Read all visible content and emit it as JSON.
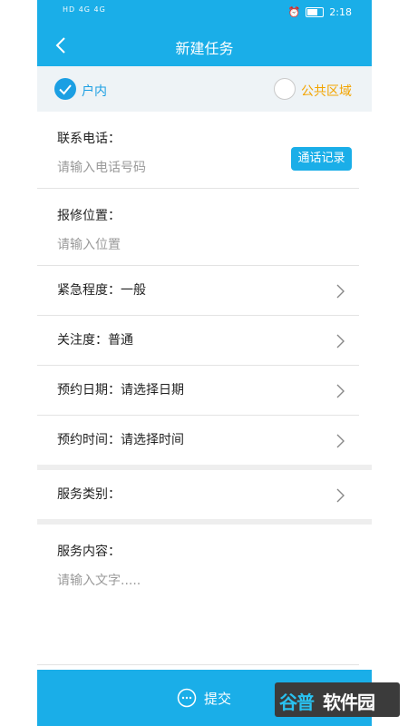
{
  "status": {
    "left_text": "HD 4G 4G",
    "time": "2:18"
  },
  "header": {
    "title": "新建任务"
  },
  "location": {
    "option_indoor": "户内",
    "option_public": "公共区域",
    "selected": "户内",
    "accent": "#1b9fe3",
    "public_color": "#f3a400"
  },
  "form": {
    "phone_label": "联系电话：",
    "phone_placeholder": "请输入电话号码",
    "call_log_button": "通话记录",
    "address_label": "报修位置：",
    "address_placeholder": "请输入位置",
    "urgency": "紧急程度：一般",
    "attention": "关注度：普通",
    "appointment_date": "预约日期：请选择日期",
    "appointment_time": "预约时间：请选择时间",
    "service_category": "服务类别：",
    "service_content_label": "服务内容：",
    "service_content_placeholder": "请输入文字....."
  },
  "submit": {
    "label": "提交"
  },
  "watermark": {
    "part1": "谷普",
    "part2": "软件园"
  },
  "colors": {
    "primary": "#1aaee8",
    "page_bg": "#ffffff",
    "section_bg": "#eef3f6"
  }
}
